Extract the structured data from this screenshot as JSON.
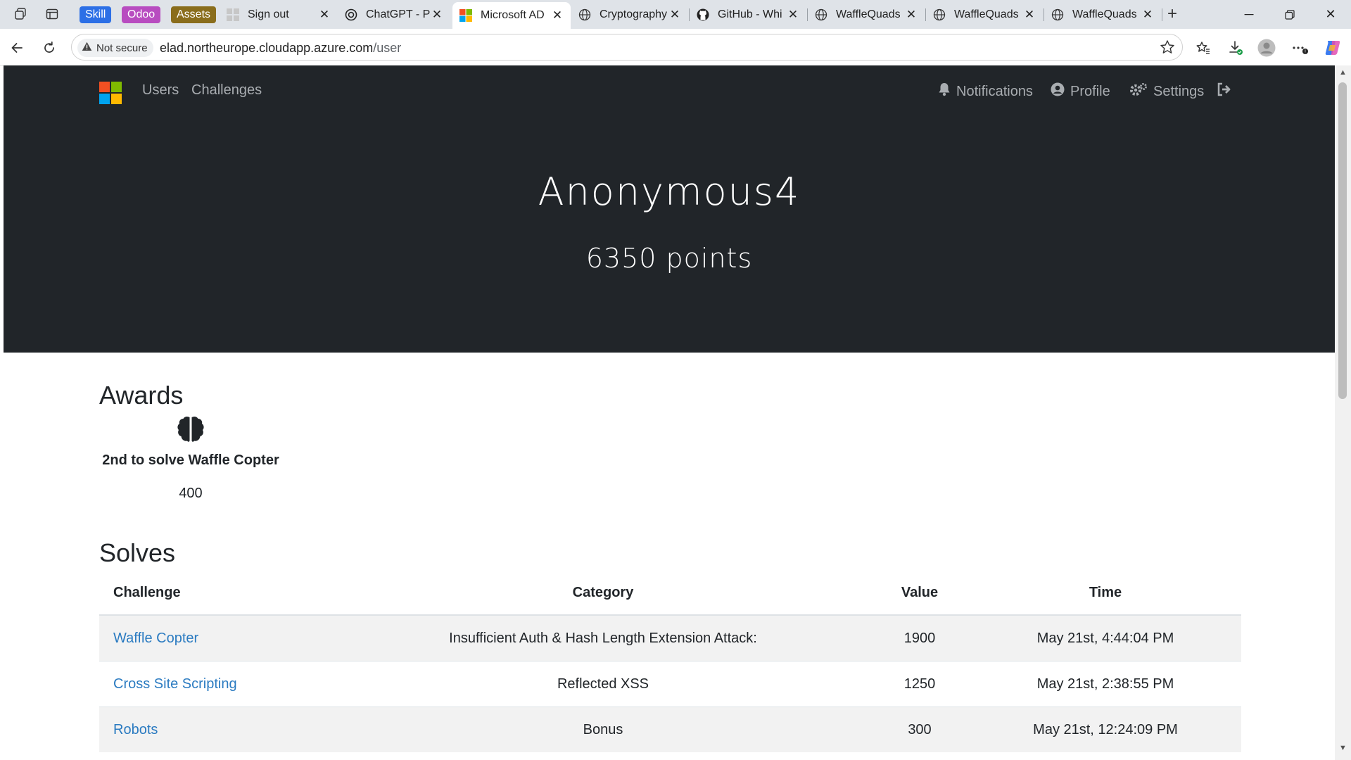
{
  "browser": {
    "pills": [
      "Skill",
      "Odoo",
      "Assets"
    ],
    "pill_colors": [
      "#2c6fe6",
      "#b84cc0",
      "#8a6d1c"
    ],
    "tabs": [
      {
        "title": "Sign out",
        "icon": "ms-grid-icon"
      },
      {
        "title": "ChatGPT - Pe",
        "icon": "chatgpt-icon"
      },
      {
        "title": "Microsoft AD",
        "icon": "microsoft-logo-icon",
        "active": true
      },
      {
        "title": "Cryptography",
        "icon": "globe-icon"
      },
      {
        "title": "GitHub - Whi",
        "icon": "github-icon"
      },
      {
        "title": "WaffleQuads",
        "icon": "globe-icon"
      },
      {
        "title": "WaffleQuads",
        "icon": "globe-icon"
      },
      {
        "title": "WaffleQuads",
        "icon": "globe-icon"
      }
    ],
    "security_label": "Not secure",
    "url_host": "elad.northeurope.cloudapp.azure.com",
    "url_path": "/user"
  },
  "nav": {
    "links": [
      "Users",
      "Challenges"
    ],
    "right": [
      "Notifications",
      "Profile",
      "Settings"
    ]
  },
  "user": {
    "name": "Anonymous4",
    "points": "6350 points"
  },
  "awards": {
    "title": "Awards",
    "items": [
      {
        "name": "2nd to solve Waffle Copter",
        "value": "400",
        "icon": "brain-icon"
      }
    ]
  },
  "solves": {
    "title": "Solves",
    "headers": [
      "Challenge",
      "Category",
      "Value",
      "Time"
    ],
    "rows": [
      {
        "challenge": "Waffle Copter",
        "category": "Insufficient Auth & Hash Length Extension Attack:",
        "value": "1900",
        "time": "May 21st, 4:44:04 PM"
      },
      {
        "challenge": "Cross Site Scripting",
        "category": "Reflected XSS",
        "value": "1250",
        "time": "May 21st, 2:38:55 PM"
      },
      {
        "challenge": "Robots",
        "category": "Bonus",
        "value": "300",
        "time": "May 21st, 12:24:09 PM"
      }
    ]
  },
  "colors": {
    "hero_bg": "#212529",
    "link": "#2b7bc1",
    "nav_text": "#a9adb1"
  }
}
